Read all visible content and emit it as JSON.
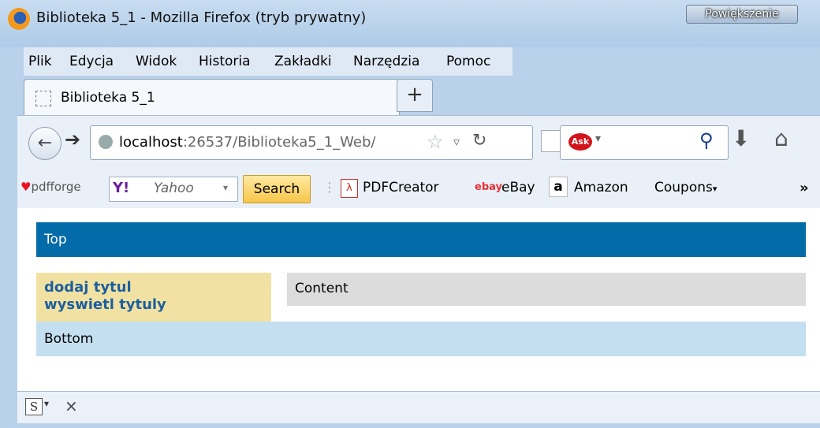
{
  "window": {
    "title": "Biblioteka 5_1 - Mozilla Firefox (tryb prywatny)",
    "zoom_label": "Powiększenie"
  },
  "menu": {
    "items": [
      "Plik",
      "Edycja",
      "Widok",
      "Historia",
      "Zakładki",
      "Narzędzia",
      "Pomoc"
    ]
  },
  "tab": {
    "label": "Biblioteka 5_1",
    "new_tab_symbol": "+"
  },
  "nav": {
    "url_host": "localhost",
    "url_path": ":26537/Biblioteka5_1_Web/",
    "search_value": ""
  },
  "toolbar": {
    "pdfforge": "pdfforge",
    "yahoo_logo": "Y!",
    "yahoo_text": "Yahoo",
    "search_label": "Search",
    "pdfcreator": "PDFCreator",
    "ebay_icon": "ebay",
    "ebay": "eBay",
    "amazon_icon": "a",
    "amazon": "Amazon",
    "coupons": "Coupons"
  },
  "page": {
    "top": "Top",
    "menu_links": [
      "dodaj tytul",
      "wyswietl tytuly"
    ],
    "content": "Content",
    "bottom": "Bottom"
  },
  "colors": {
    "top_bar": "#036ba8",
    "menu_col": "#f1e2a3",
    "content_box": "#dcdcdc",
    "bottom_bar": "#c4dff0",
    "link": "#1d5f9e"
  },
  "icons": [
    "firefox-logo",
    "back-arrow-icon",
    "forward-arrow-icon",
    "globe-icon",
    "star-icon",
    "dropmark-icon",
    "reload-icon",
    "ask-icon",
    "magnifier-icon",
    "download-icon",
    "home-icon",
    "pdfcreator-icon",
    "ebay-icon",
    "amazon-icon",
    "more-icon",
    "s-icon",
    "close-icon"
  ]
}
